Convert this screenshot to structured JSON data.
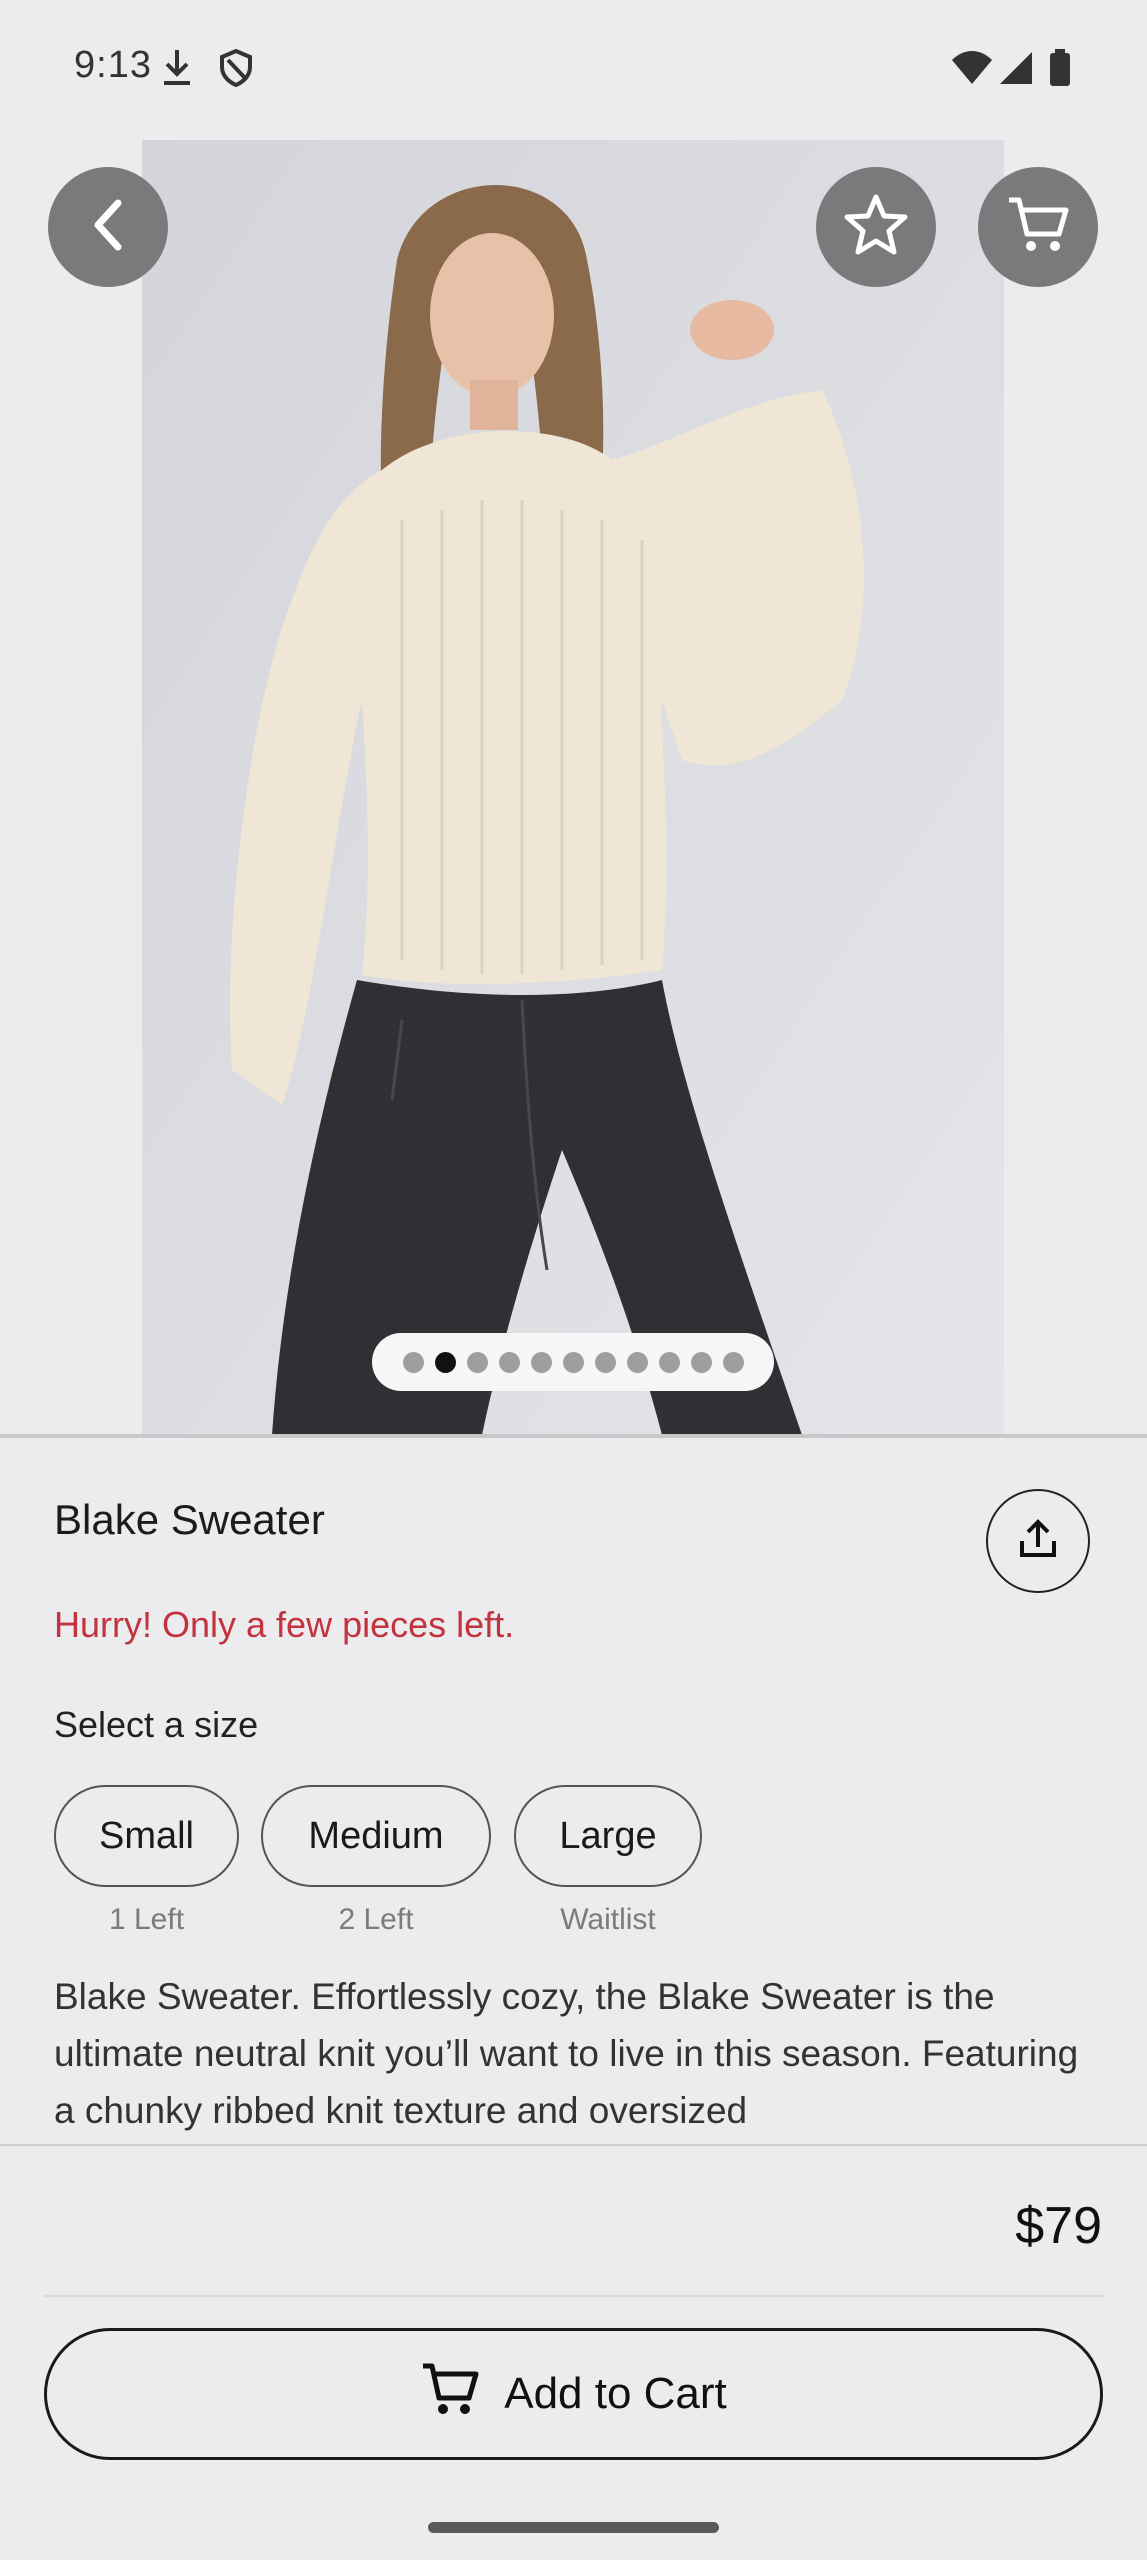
{
  "status_bar": {
    "time": "9:13",
    "icons": [
      "download-icon",
      "shield-icon",
      "wifi-icon",
      "cellular-icon",
      "battery-icon"
    ]
  },
  "hero": {
    "image_alt": "Model wearing cream chunky knit sweater and black jeans",
    "carousel": {
      "total": 11,
      "active_index": 1
    },
    "buttons": [
      "back-arrow-icon",
      "star-icon",
      "cart-icon"
    ]
  },
  "product": {
    "title": "Blake Sweater",
    "stock_warning": "Hurry! Only a few pieces left.",
    "size_heading": "Select a size",
    "sizes": [
      {
        "label": "Small",
        "availability": "1 Left"
      },
      {
        "label": "Medium",
        "availability": "2 Left"
      },
      {
        "label": "Large",
        "availability": "Waitlist"
      }
    ],
    "description": "Blake Sweater. Effortlessly cozy, the Blake Sweater is the ultimate neutral knit you’ll want to live in this season. Featuring a chunky ribbed knit texture and oversized",
    "price": "$79"
  },
  "actions": {
    "add_to_cart_label": "Add to Cart"
  },
  "colors": {
    "accent_warning": "#c2333e",
    "background": "#ecebee",
    "overlay_button": "#7a797c"
  }
}
